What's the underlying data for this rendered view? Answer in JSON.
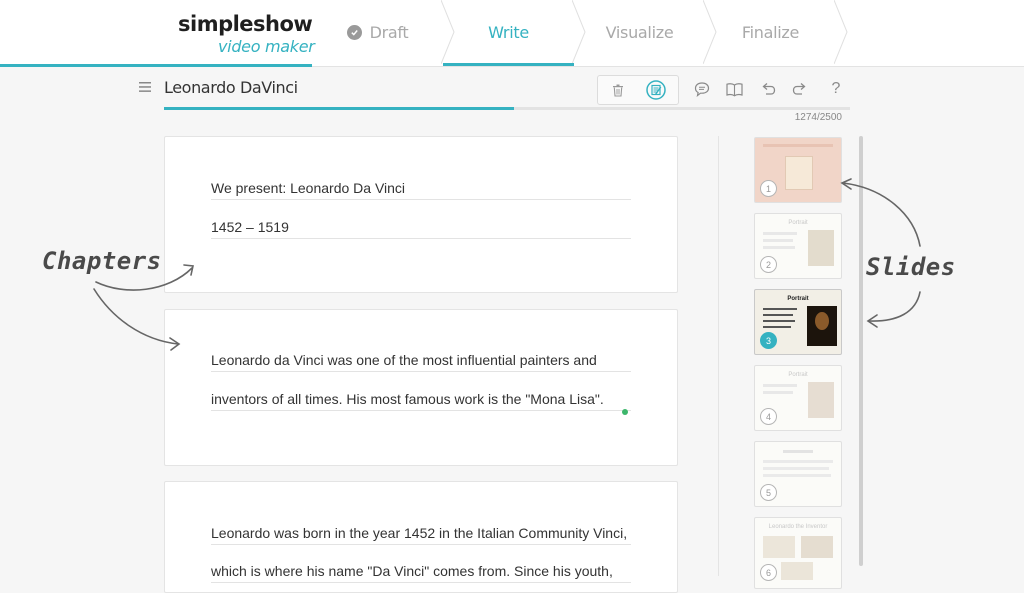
{
  "logo": {
    "main": "simpleshow",
    "sub": "video maker"
  },
  "steps": [
    {
      "label": "Draft",
      "state": "done"
    },
    {
      "label": "Write",
      "state": "active"
    },
    {
      "label": "Visualize",
      "state": "todo"
    },
    {
      "label": "Finalize",
      "state": "todo"
    }
  ],
  "document": {
    "title": "Leonardo DaVinci",
    "char_count": "1274/2500",
    "progress": 0.51
  },
  "toolbar": {
    "icons": [
      "trash-icon",
      "edit-note-icon",
      "comment-icon",
      "book-icon",
      "undo-icon",
      "redo-icon",
      "help-icon"
    ],
    "help_label": "?"
  },
  "chapters": [
    {
      "lines": [
        "We present: Leonardo Da Vinci",
        "1452 – 1519"
      ]
    },
    {
      "lines": [
        "Leonardo da Vinci was one of the most influential painters and",
        "inventors of all times. His most famous work is the \"Mona Lisa\"."
      ]
    },
    {
      "lines": [
        "Leonardo was born in the year 1452 in the Italian Community Vinci,",
        "which is where his name \"Da Vinci\" comes from. Since his youth,"
      ]
    }
  ],
  "slides": [
    {
      "number": "1",
      "title": "",
      "active": false
    },
    {
      "number": "2",
      "title": "Portrait",
      "active": false
    },
    {
      "number": "3",
      "title": "Portrait",
      "active": true
    },
    {
      "number": "4",
      "title": "Portrait",
      "active": false
    },
    {
      "number": "5",
      "title": "",
      "active": false
    },
    {
      "number": "6",
      "title": "Leonardo the Inventor",
      "active": false
    }
  ],
  "annotations": {
    "left": "Chapters",
    "right": "Slides"
  },
  "colors": {
    "accent": "#35b2c1",
    "cursor": "#3cb66b"
  }
}
